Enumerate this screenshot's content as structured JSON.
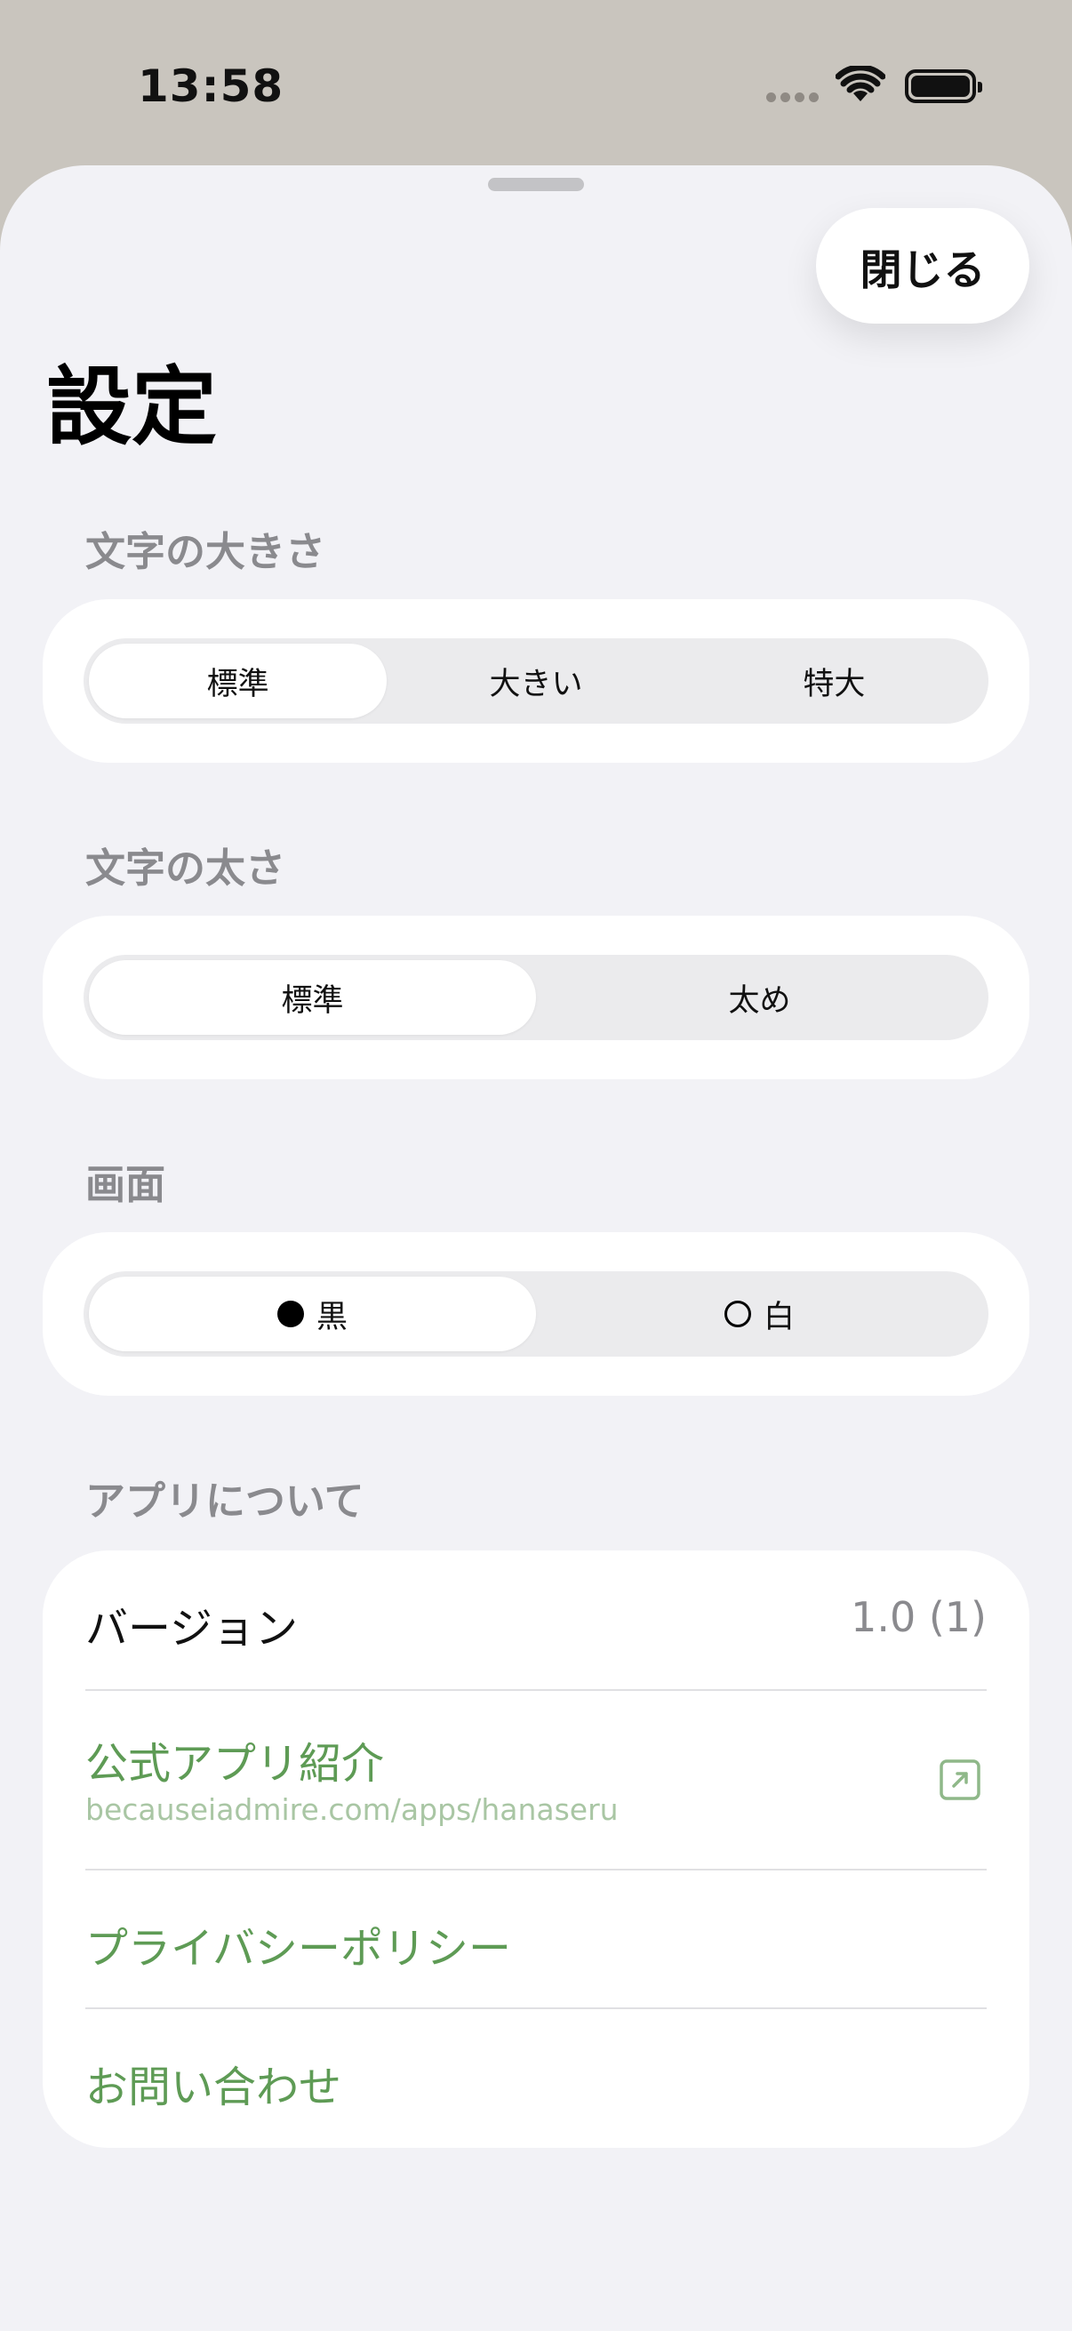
{
  "status_bar": {
    "time": "13:58"
  },
  "header": {
    "title": "設定",
    "close_label": "閉じる"
  },
  "font_size": {
    "title": "文字の大きさ",
    "options": [
      "標準",
      "大きい",
      "特大"
    ],
    "selected": "標準"
  },
  "font_weight": {
    "title": "文字の太さ",
    "options": [
      "標準",
      "太め"
    ],
    "selected": "標準"
  },
  "screen": {
    "title": "画面",
    "options": [
      "黒",
      "白"
    ],
    "selected": "黒"
  },
  "about": {
    "title": "アプリについて",
    "version_label": "バージョン",
    "version_value": "1.0 (1)",
    "official_label": "公式アプリ紹介",
    "official_url": "becauseiadmire.com/apps/hanaseru",
    "privacy_label": "プライバシーポリシー",
    "contact_label": "お問い合わせ"
  },
  "colors": {
    "accent": "#5e9b55",
    "background": "#f2f2f6"
  },
  "icons": [
    "wifi-icon",
    "battery-icon",
    "external-link-icon"
  ]
}
